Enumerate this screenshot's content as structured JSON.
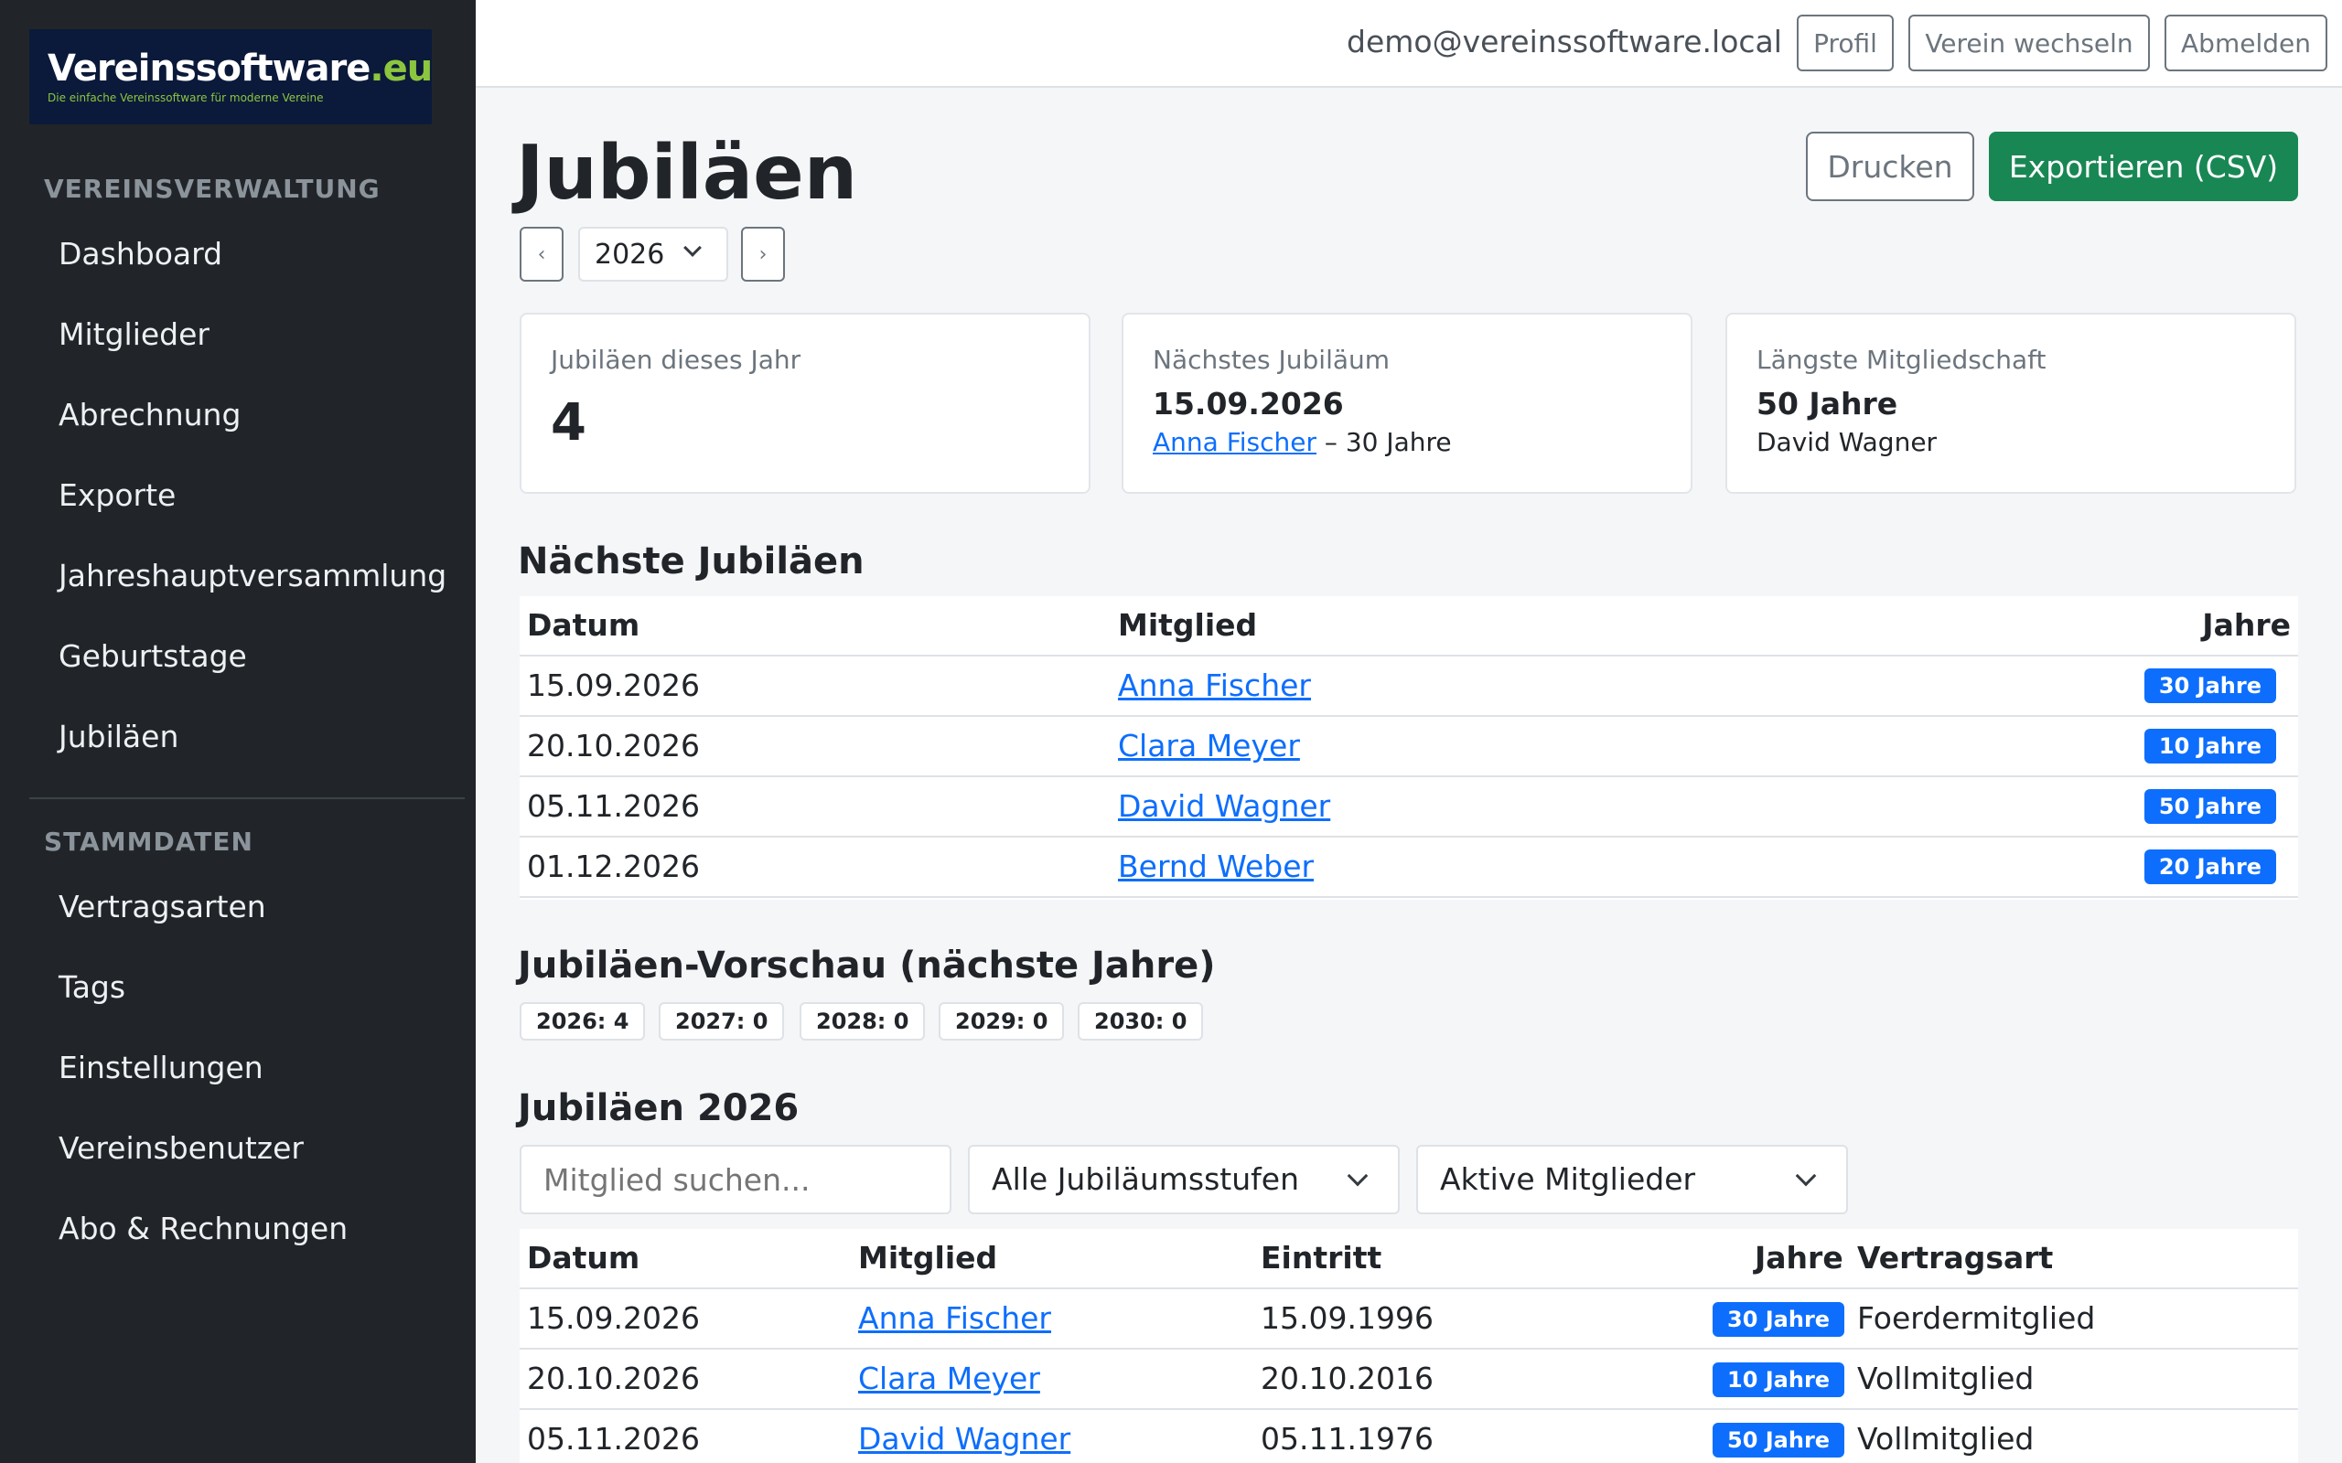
{
  "sidebar": {
    "logo": {
      "name": "Vereinssoftware",
      "tld": ".eu",
      "tagline": "Die einfache Vereinssoftware für moderne Vereine"
    },
    "sections": [
      {
        "heading": "VEREINSVERWALTUNG",
        "items": [
          "Dashboard",
          "Mitglieder",
          "Abrechnung",
          "Exporte",
          "Jahreshauptversammlung",
          "Geburtstage",
          "Jubiläen"
        ]
      },
      {
        "heading": "STAMMDATEN",
        "items": [
          "Vertragsarten",
          "Tags",
          "Einstellungen",
          "Vereinsbenutzer",
          "Abo & Rechnungen"
        ]
      }
    ]
  },
  "topbar": {
    "email": "demo@vereinssoftware.local",
    "profile": "Profil",
    "switch": "Verein wechseln",
    "logout": "Abmelden"
  },
  "page": {
    "title": "Jubiläen",
    "print": "Drucken",
    "export": "Exportieren (CSV)",
    "year": "2026",
    "prev": "‹",
    "next": "›"
  },
  "cards": {
    "count": {
      "label": "Jubiläen dieses Jahr",
      "value": "4"
    },
    "next": {
      "label": "Nächstes Jubiläum",
      "date": "15.09.2026",
      "member": "Anna Fischer",
      "suffix": " – 30 Jahre"
    },
    "longest": {
      "label": "Längste Mitgliedschaft",
      "value": "50 Jahre",
      "member": "David Wagner"
    }
  },
  "upcoming": {
    "title": "Nächste Jubiläen",
    "headers": {
      "date": "Datum",
      "member": "Mitglied",
      "years": "Jahre"
    },
    "rows": [
      {
        "date": "15.09.2026",
        "member": "Anna Fischer",
        "years": "30 Jahre"
      },
      {
        "date": "20.10.2026",
        "member": "Clara Meyer",
        "years": "10 Jahre"
      },
      {
        "date": "05.11.2026",
        "member": "David Wagner",
        "years": "50 Jahre"
      },
      {
        "date": "01.12.2026",
        "member": "Bernd Weber",
        "years": "20 Jahre"
      }
    ]
  },
  "preview": {
    "title": "Jubiläen-Vorschau (nächste Jahre)",
    "pills": [
      "2026: 4",
      "2027: 0",
      "2028: 0",
      "2029: 0",
      "2030: 0"
    ]
  },
  "yearTable": {
    "title": "Jubiläen 2026",
    "search_placeholder": "Mitglied suchen...",
    "level_filter": "Alle Jubiläumsstufen",
    "status_filter": "Aktive Mitglieder",
    "headers": {
      "date": "Datum",
      "member": "Mitglied",
      "entry": "Eintritt",
      "years": "Jahre",
      "contract": "Vertragsart"
    },
    "rows": [
      {
        "date": "15.09.2026",
        "member": "Anna Fischer",
        "entry": "15.09.1996",
        "years": "30 Jahre",
        "contract": "Foerdermitglied"
      },
      {
        "date": "20.10.2026",
        "member": "Clara Meyer",
        "entry": "20.10.2016",
        "years": "10 Jahre",
        "contract": "Vollmitglied"
      },
      {
        "date": "05.11.2026",
        "member": "David Wagner",
        "entry": "05.11.1976",
        "years": "50 Jahre",
        "contract": "Vollmitglied"
      }
    ]
  },
  "colors": {
    "sidebar": "#212529",
    "primary": "#0d6efd",
    "success": "#198754",
    "muted": "#6c757d"
  }
}
